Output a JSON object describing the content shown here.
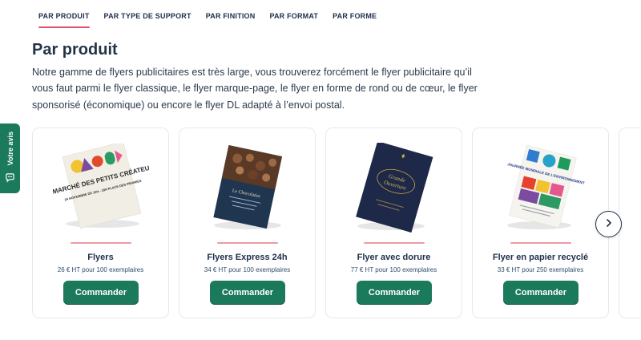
{
  "tabs": [
    {
      "label": "PAR PRODUIT",
      "active": true
    },
    {
      "label": "PAR TYPE DE SUPPORT"
    },
    {
      "label": "PAR FINITION"
    },
    {
      "label": "PAR FORMAT"
    },
    {
      "label": "PAR FORME"
    }
  ],
  "section": {
    "title": "Par produit",
    "intro": "Notre gamme de flyers publicitaires est très large, vous trouverez forcément le flyer publicitaire qu’il vous faut parmi le flyer classique, le flyer marque-page, le flyer en forme de rond ou de cœur, le flyer sponsorisé (économique) ou encore le flyer DL adapté à l’envoi postal."
  },
  "feedback": {
    "label": "Votre avis",
    "icon": "chat-bubble-icon"
  },
  "products": [
    {
      "name": "Flyers",
      "price": "26 € HT pour 100 exemplaires",
      "cta": "Commander",
      "flyer": {
        "poster_text": "LE MARCHÉ DES PETITS CRÉATEURS",
        "sub_text": "24 NOVEMBRE DE 10H - 18H PLACE DES PRAIRIES"
      }
    },
    {
      "name": "Flyers Express 24h",
      "price": "34 € HT pour 100 exemplaires",
      "cta": "Commander",
      "flyer": {
        "poster_text": "Le Chocolatier"
      }
    },
    {
      "name": "Flyer avec dorure",
      "price": "77 € HT pour 100 exemplaires",
      "cta": "Commander",
      "flyer": {
        "poster_text_1": "Grande",
        "poster_text_2": "Ouverture"
      }
    },
    {
      "name": "Flyer en papier recyclé",
      "price": "33 € HT pour 250 exemplaires",
      "cta": "Commander",
      "flyer": {
        "poster_text": "JOURNÉE MONDIALE DE L'ENVIRONNEMENT"
      }
    }
  ],
  "carousel": {
    "next_icon": "chevron-right-icon"
  },
  "colors": {
    "accent": "#1c7a5c",
    "underline": "#e0576b",
    "divider": "#ef9aa4",
    "navy": "#1f2f4a"
  }
}
